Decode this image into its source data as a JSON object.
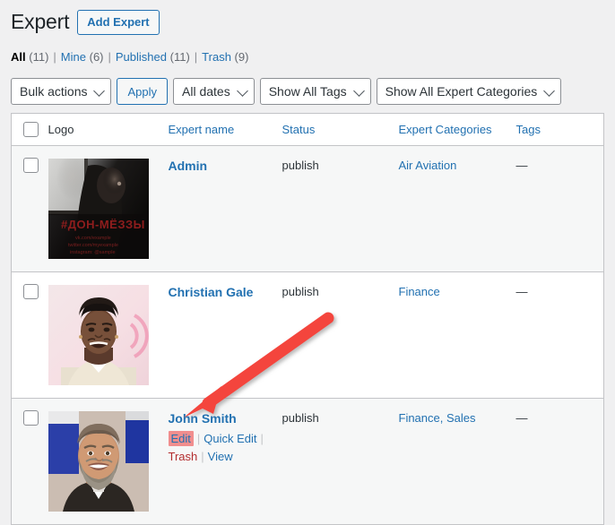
{
  "header": {
    "page_title": "Expert",
    "add_button_label": "Add Expert"
  },
  "views": {
    "all": {
      "label": "All",
      "count": "(11)"
    },
    "mine": {
      "label": "Mine",
      "count": "(6)"
    },
    "published": {
      "label": "Published",
      "count": "(11)"
    },
    "trash": {
      "label": "Trash",
      "count": "(9)"
    },
    "separator": "|"
  },
  "toolbar": {
    "bulk_actions_value": "Bulk actions",
    "apply_label": "Apply",
    "dates_filter_value": "All dates",
    "tags_filter_value": "Show All Tags",
    "categories_filter_value": "Show All Expert Categories"
  },
  "table": {
    "columns": {
      "logo": "Logo",
      "name": "Expert name",
      "status": "Status",
      "categories": "Expert Categories",
      "tags": "Tags"
    },
    "rows": [
      {
        "name": "Admin",
        "status": "publish",
        "categories": "Air Aviation",
        "tags": "—",
        "thumb_alt": "dark-window-portrait-thumbnail"
      },
      {
        "name": "Christian Gale",
        "status": "publish",
        "categories": "Finance",
        "tags": "—",
        "thumb_alt": "smiling-man-portrait-thumbnail"
      },
      {
        "name": "John Smith",
        "status": "publish",
        "categories": "Finance, Sales",
        "tags": "—",
        "thumb_alt": "bearded-man-portrait-thumbnail",
        "actions": {
          "edit": "Edit",
          "quick_edit": "Quick Edit",
          "trash": "Trash",
          "view": "View"
        }
      }
    ]
  },
  "annotation": {
    "arrow_color": "#f4453c",
    "highlight_color": "#f18e8e",
    "arrow_target": "edit-link"
  },
  "colors": {
    "link": "#2271b1",
    "page_background": "#f0f0f1",
    "row_alt_background": "#f6f7f7",
    "trash_link": "#b32d2e"
  }
}
